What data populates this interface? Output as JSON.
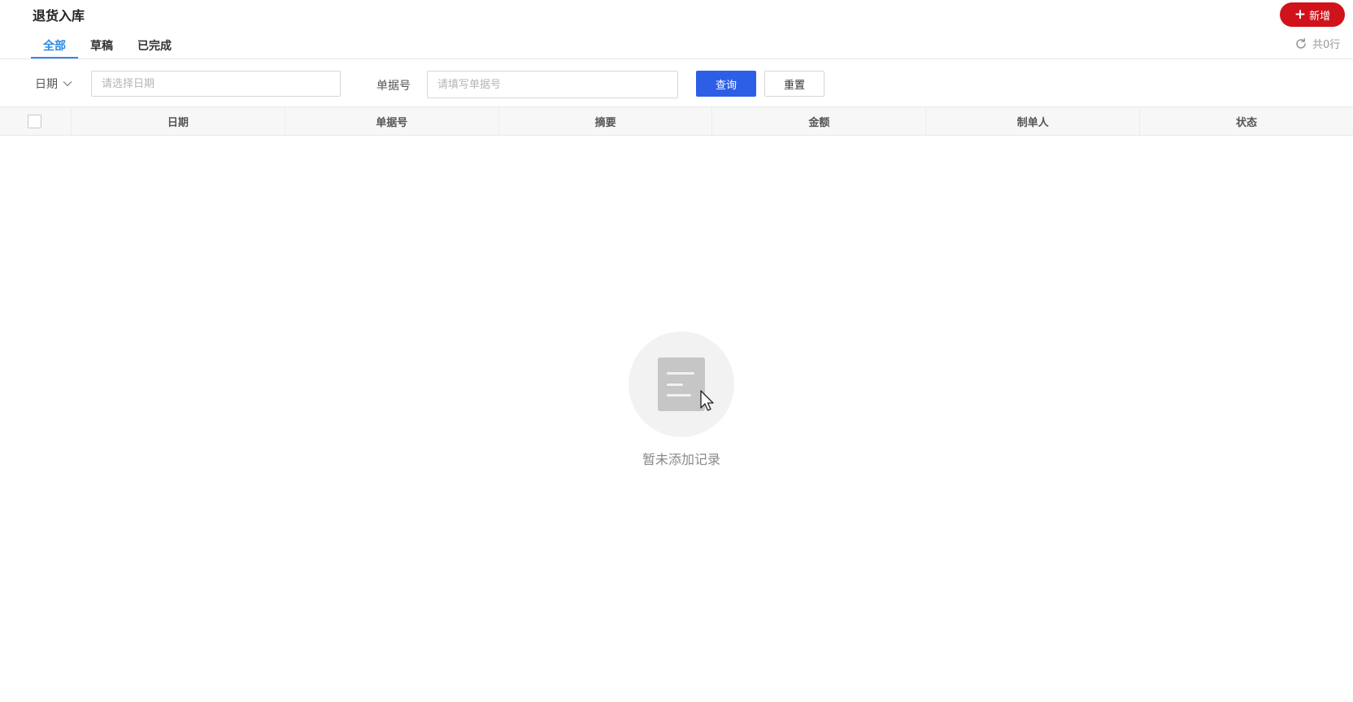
{
  "header": {
    "title": "退货入库",
    "add_button_label": "新增"
  },
  "tabs": [
    {
      "label": "全部",
      "active": true
    },
    {
      "label": "草稿",
      "active": false
    },
    {
      "label": "已完成",
      "active": false
    }
  ],
  "toolbar": {
    "row_count": "共0行"
  },
  "filters": {
    "date_select_label": "日期",
    "date_placeholder": "请选择日期",
    "bill_label": "单据号",
    "bill_placeholder": "请填写单据号",
    "query_label": "查询",
    "reset_label": "重置"
  },
  "table": {
    "columns": [
      "日期",
      "单据号",
      "摘要",
      "金额",
      "制单人",
      "状态"
    ],
    "rows": []
  },
  "empty_state": {
    "text": "暂未添加记录"
  },
  "colors": {
    "brand_red": "#d0121b",
    "primary_blue": "#2d5fe6",
    "tab_active": "#2e8ae6"
  },
  "icons": {
    "add": "plus-icon",
    "refresh": "refresh-icon",
    "dropdown": "chevron-down-icon",
    "empty": "document-icon"
  }
}
